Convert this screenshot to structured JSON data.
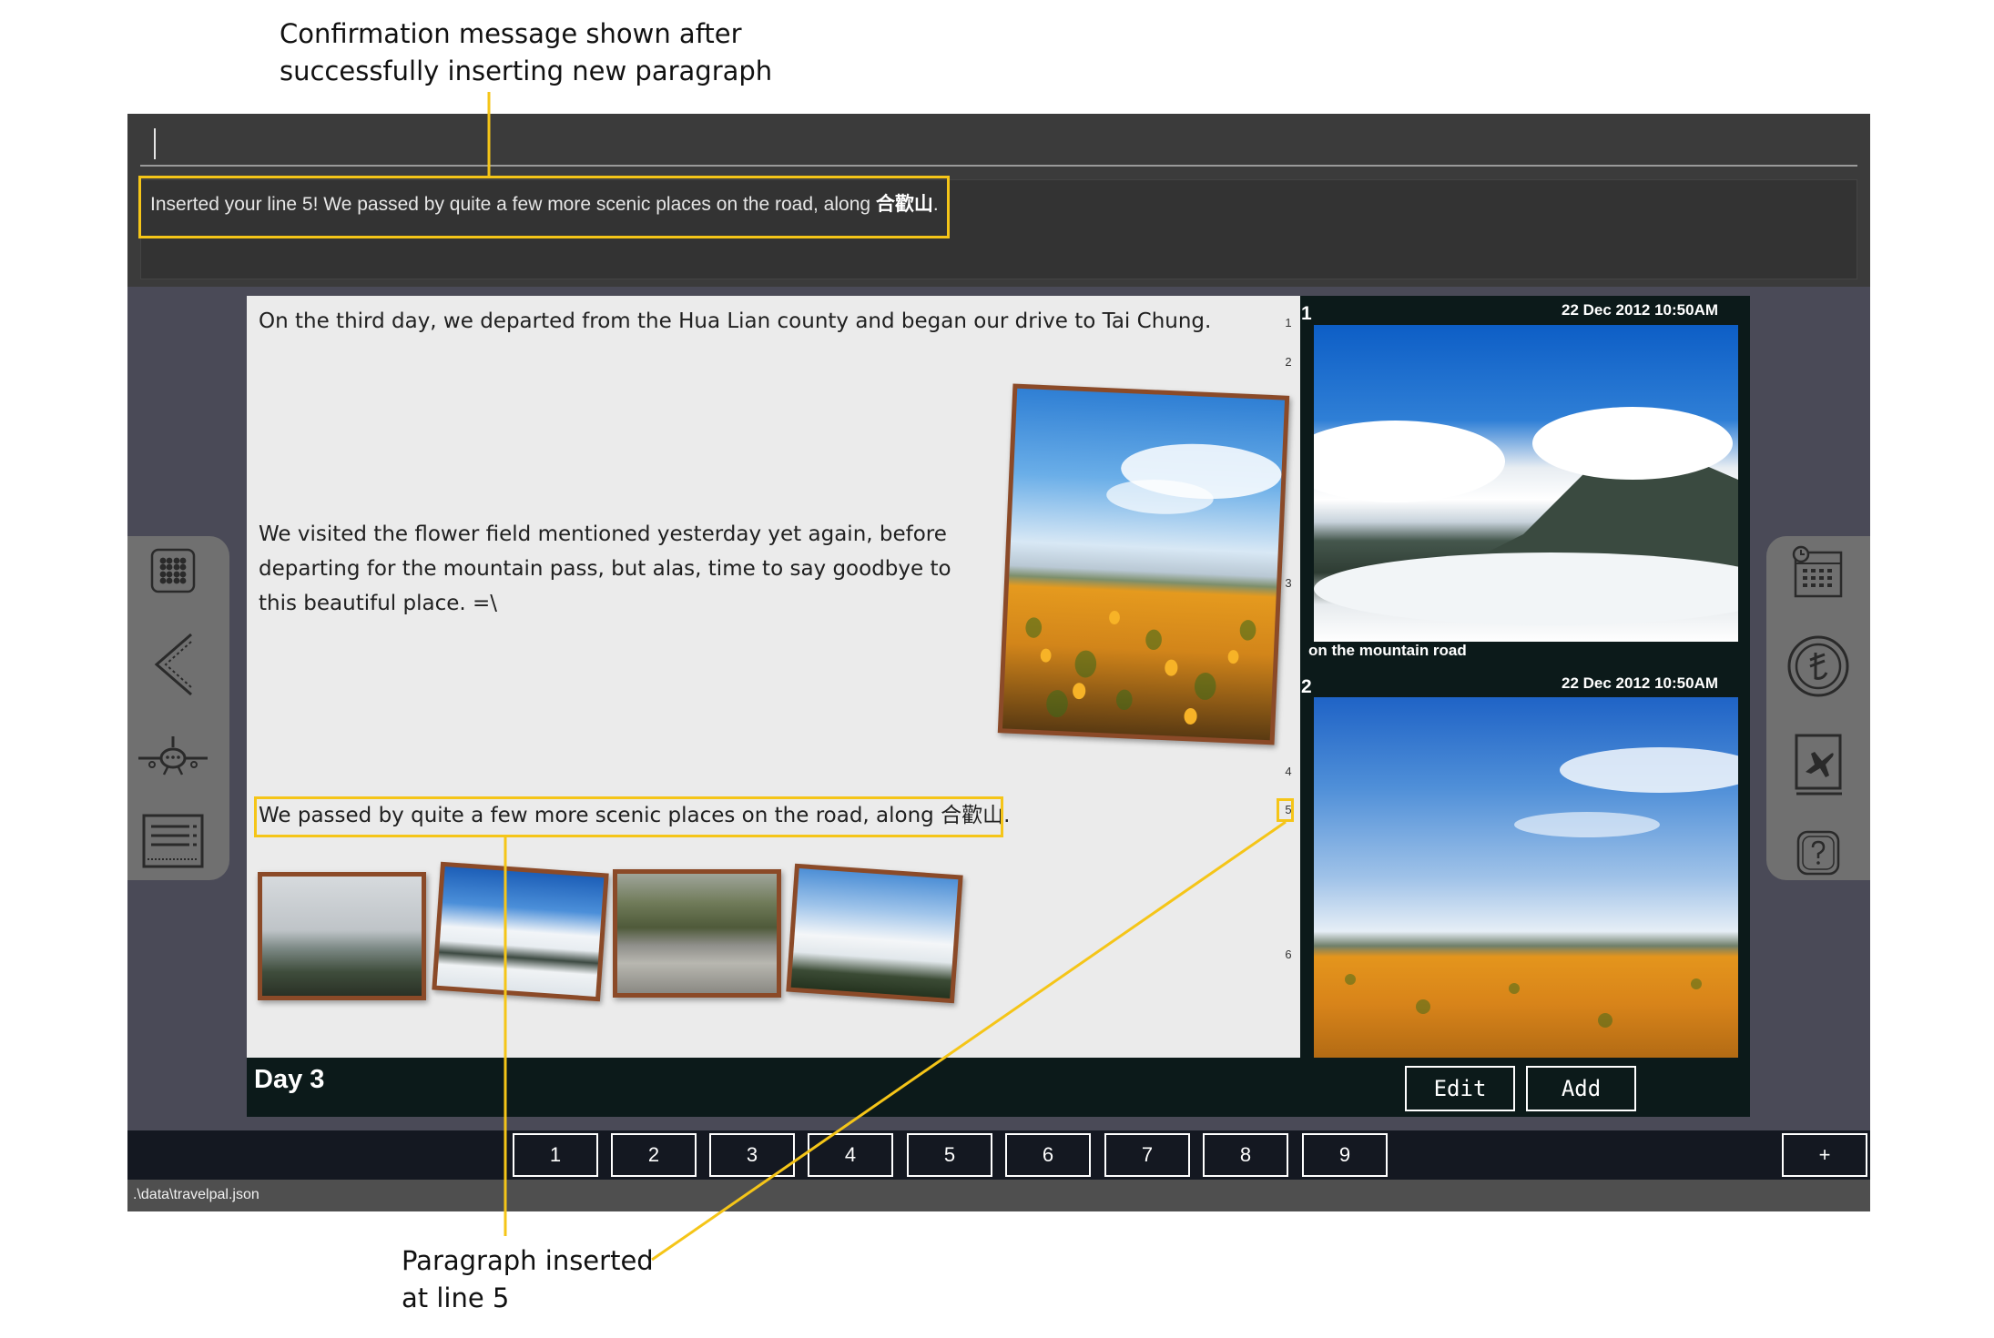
{
  "annotations": {
    "top_line1": "Confirmation message shown after",
    "top_line2": "successfully inserting new paragraph",
    "bottom_line1": "Paragraph inserted",
    "bottom_line2": "at line 5",
    "color": "#f5c518"
  },
  "command": {
    "input_value": "",
    "result_prefix": "Inserted your line 5! We passed by quite a few more scenic places on the road, along ",
    "result_cjk": "合歡山",
    "result_suffix": "."
  },
  "left_toolbar": {
    "icons": [
      "grid-icon",
      "back-chevron-icon",
      "airplane-icon",
      "list-view-icon"
    ]
  },
  "right_toolbar": {
    "icons": [
      "calendar-icon",
      "currency-icon",
      "travel-book-icon",
      "help-icon"
    ]
  },
  "journal": {
    "paragraphs": {
      "p1": "On the third day, we departed from the Hua Lian county and began our drive to Tai Chung.",
      "p3_line1": "We visited the flower field mentioned yesterday yet again, before",
      "p3_line2": "departing for the mountain pass, but alas, time to say goodbye to",
      "p3_line3": "this beautiful place. =\\",
      "p5": "We passed by quite a few more scenic places on the road, along 合歡山."
    },
    "line_numbers": [
      "1",
      "2",
      "3",
      "4",
      "5",
      "6"
    ],
    "day_title": "Day 3",
    "gallery": [
      {
        "index": "1",
        "timestamp": "22 Dec 2012 10:50AM",
        "caption": "on the mountain road"
      },
      {
        "index": "2",
        "timestamp": "22 Dec 2012 10:50AM",
        "caption": ""
      }
    ],
    "edit_label": "Edit",
    "add_label": "Add"
  },
  "pages": [
    "1",
    "2",
    "3",
    "4",
    "5",
    "6",
    "7",
    "8",
    "9"
  ],
  "add_page_label": "+",
  "status": {
    "file_path": ".\\data\\travelpal.json"
  },
  "colors": {
    "highlight": "#f5c518",
    "app_bg": "#4a4a57",
    "frame": "#8b4a28"
  }
}
